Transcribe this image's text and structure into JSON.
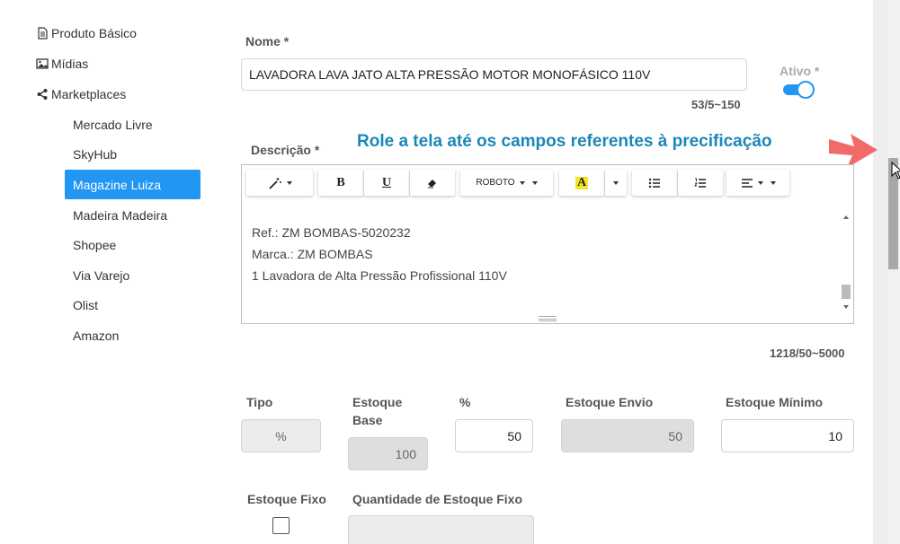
{
  "sidebar": {
    "produto_basico": "Produto Básico",
    "midias": "Mídias",
    "marketplaces": "Marketplaces",
    "items": [
      {
        "label": "Mercado Livre"
      },
      {
        "label": "SkyHub"
      },
      {
        "label": "Magazine Luiza"
      },
      {
        "label": "Madeira Madeira"
      },
      {
        "label": "Shopee"
      },
      {
        "label": "Via Varejo"
      },
      {
        "label": "Olist"
      },
      {
        "label": "Amazon"
      }
    ],
    "active_index": 2
  },
  "form": {
    "nome_label": "Nome *",
    "nome_value": "LAVADORA LAVA JATO ALTA PRESSÃO MOTOR MONOFÁSICO 110V",
    "nome_counter": "53/5~150",
    "ativo_label": "Ativo *",
    "ativo_on": true,
    "descricao_label": "Descrição *",
    "descricao_lines": [
      "Ref.: ZM BOMBAS-5020232",
      "Marca.: ZM BOMBAS",
      "1 Lavadora de Alta Pressão Profissional 110V"
    ],
    "descricao_counter": "1218/50~5000",
    "tipo_label": "Tipo",
    "tipo_value": "%",
    "estoque_base_label": "Estoque Base",
    "estoque_base_value": "100",
    "pct_label": "%",
    "pct_value": "50",
    "estoque_envio_label": "Estoque Envio",
    "estoque_envio_value": "50",
    "estoque_minimo_label": "Estoque Mínimo",
    "estoque_minimo_value": "10",
    "estoque_fixo_label": "Estoque Fixo",
    "estoque_fixo_checked": false,
    "qtd_estoque_fixo_label": "Quantidade de Estoque Fixo"
  },
  "editor_toolbar": {
    "bold": "B",
    "underline": "U",
    "font_name": "ROBOTO",
    "color_letter": "A"
  },
  "hint_text": "Role a tela até os campos referentes à precificação",
  "colors": {
    "accent": "#2196f3",
    "hint": "#1a87b8",
    "arrow": "#f26b6b",
    "highlight": "#f5e52a"
  }
}
